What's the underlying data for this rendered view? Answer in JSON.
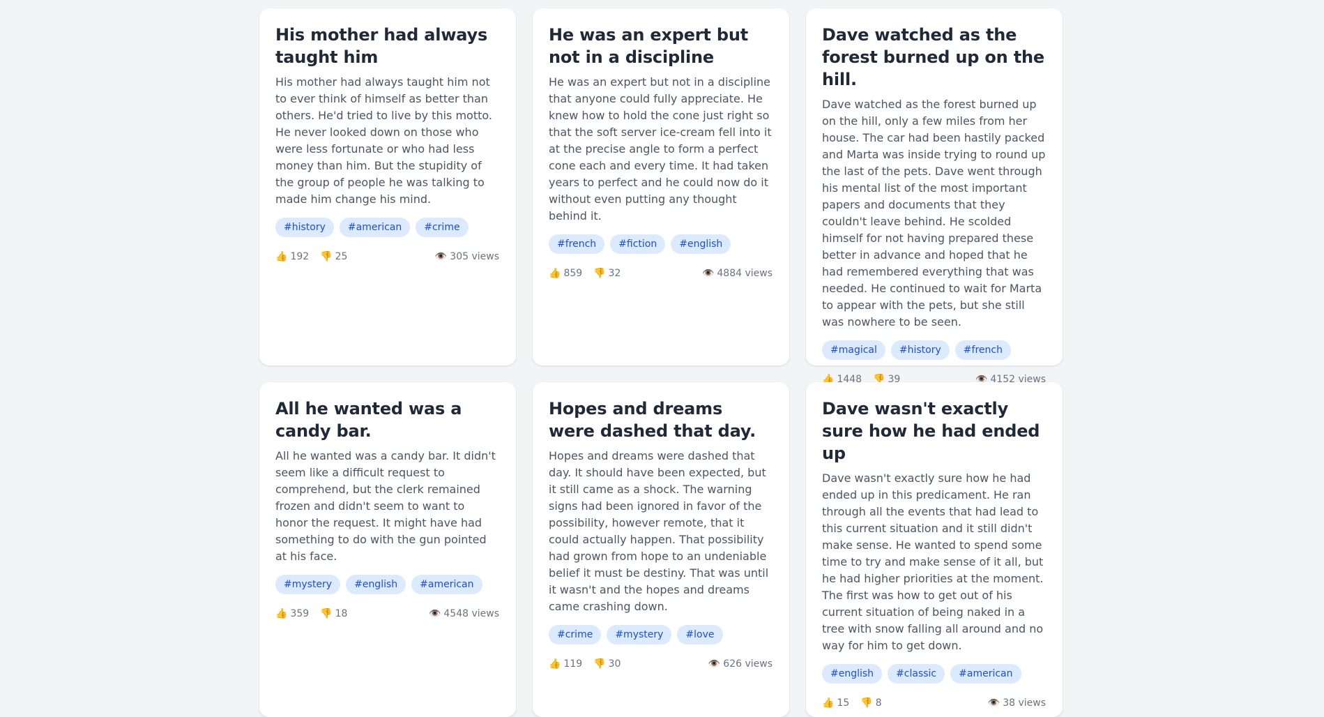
{
  "posts": [
    {
      "title": "His mother had always taught him",
      "body": "His mother had always taught him not to ever think of himself as better than others. He'd tried to live by this motto. He never looked down on those who were less fortunate or who had less money than him. But the stupidity of the group of people he was talking to made him change his mind.",
      "tags": [
        "#history",
        "#american",
        "#crime"
      ],
      "likes": "192",
      "dislikes": "25",
      "views": "305 views"
    },
    {
      "title": "He was an expert but not in a discipline",
      "body": "He was an expert but not in a discipline that anyone could fully appreciate. He knew how to hold the cone just right so that the soft server ice-cream fell into it at the precise angle to form a perfect cone each and every time. It had taken years to perfect and he could now do it without even putting any thought behind it.",
      "tags": [
        "#french",
        "#fiction",
        "#english"
      ],
      "likes": "859",
      "dislikes": "32",
      "views": "4884 views"
    },
    {
      "title": "Dave watched as the forest burned up on the hill.",
      "body": "Dave watched as the forest burned up on the hill, only a few miles from her house. The car had been hastily packed and Marta was inside trying to round up the last of the pets. Dave went through his mental list of the most important papers and documents that they couldn't leave behind. He scolded himself for not having prepared these better in advance and hoped that he had remembered everything that was needed. He continued to wait for Marta to appear with the pets, but she still was nowhere to be seen.",
      "tags": [
        "#magical",
        "#history",
        "#french"
      ],
      "likes": "1448",
      "dislikes": "39",
      "views": "4152 views"
    },
    {
      "title": "All he wanted was a candy bar.",
      "body": "All he wanted was a candy bar. It didn't seem like a difficult request to comprehend, but the clerk remained frozen and didn't seem to want to honor the request. It might have had something to do with the gun pointed at his face.",
      "tags": [
        "#mystery",
        "#english",
        "#american"
      ],
      "likes": "359",
      "dislikes": "18",
      "views": "4548 views"
    },
    {
      "title": "Hopes and dreams were dashed that day.",
      "body": "Hopes and dreams were dashed that day. It should have been expected, but it still came as a shock. The warning signs had been ignored in favor of the possibility, however remote, that it could actually happen. That possibility had grown from hope to an undeniable belief it must be destiny. That was until it wasn't and the hopes and dreams came crashing down.",
      "tags": [
        "#crime",
        "#mystery",
        "#love"
      ],
      "likes": "119",
      "dislikes": "30",
      "views": "626 views"
    },
    {
      "title": "Dave wasn't exactly sure how he had ended up",
      "body": "Dave wasn't exactly sure how he had ended up in this predicament. He ran through all the events that had lead to this current situation and it still didn't make sense. He wanted to spend some time to try and make sense of it all, but he had higher priorities at the moment. The first was how to get out of his current situation of being naked in a tree with snow falling all around and no way for him to get down.",
      "tags": [
        "#english",
        "#classic",
        "#american"
      ],
      "likes": "15",
      "dislikes": "8",
      "views": "38 views"
    }
  ],
  "icons": {
    "like": "thumbs-up-icon",
    "dislike": "thumbs-down-icon",
    "views": "eye-icon"
  },
  "colors": {
    "background": "#f3f4f6",
    "card": "#ffffff",
    "title": "#1f2937",
    "body": "#4b5563",
    "tag_bg": "#dbeafe",
    "tag_text": "#1d4ed8",
    "meta": "#6b7280"
  }
}
